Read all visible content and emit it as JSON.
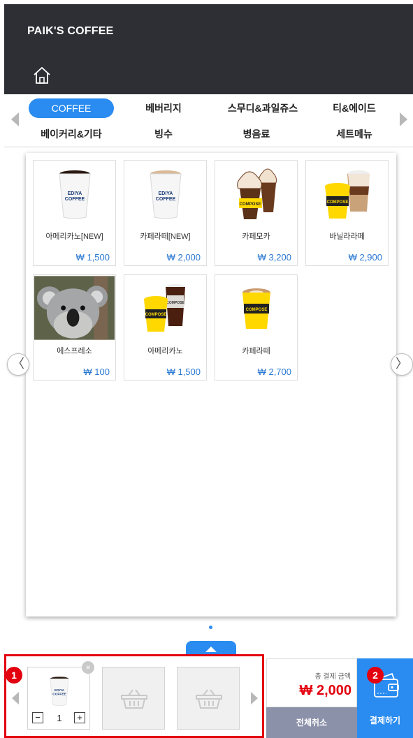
{
  "app": {
    "brand": "PAIK'S COFFEE"
  },
  "categories": [
    {
      "label": "COFFEE",
      "active": true
    },
    {
      "label": "베버리지",
      "active": false
    },
    {
      "label": "스무디&과일쥬스",
      "active": false
    },
    {
      "label": "티&에이드",
      "active": false
    },
    {
      "label": "베이커리&기타",
      "active": false
    },
    {
      "label": "빙수",
      "active": false
    },
    {
      "label": "병음료",
      "active": false
    },
    {
      "label": "세트메뉴",
      "active": false
    }
  ],
  "menu": [
    {
      "name": "아메리카노[NEW]",
      "price": "₩ 1,500",
      "cup_text": "EDIYA COFFEE",
      "image": "ediya-hot-cup"
    },
    {
      "name": "카페라떼[NEW]",
      "price": "₩ 2,000",
      "cup_text": "EDIYA COFFEE",
      "image": "ediya-latte-cup"
    },
    {
      "name": "카페모카",
      "price": "₩ 3,200",
      "cup_text": "COMPOSE",
      "image": "mocha-cup"
    },
    {
      "name": "바닐라라떼",
      "price": "₩ 2,900",
      "cup_text": "COMPOSE",
      "image": "vanilla-latte-cups"
    },
    {
      "name": "에스프레소",
      "price": "₩ 100",
      "image": "koala-photo"
    },
    {
      "name": "아메리카노",
      "price": "₩ 1,500",
      "cup_text": "COMPOSE",
      "image": "iced-americano-cups"
    },
    {
      "name": "카페라떼",
      "price": "₩ 2,700",
      "cup_text": "COMPOSE",
      "image": "cafe-latte-cup"
    }
  ],
  "cart": {
    "items": [
      {
        "image": "ediya-hot-cup",
        "quantity": "1",
        "remove": "×",
        "minus": "−",
        "plus": "+"
      }
    ],
    "empty_slots": 2
  },
  "checkout": {
    "total_label": "총 결제 금액",
    "total_amount": "₩ 2,000",
    "cancel_all": "전체취소",
    "pay": "결제하기"
  },
  "annotations": {
    "cart_badge": "1",
    "pay_badge": "2"
  },
  "colors": {
    "accent": "#2a8cf0",
    "header_bg": "#2d2f34",
    "price": "#2a79d3",
    "highlight": "#e3000f",
    "cancel_bg": "#8b91a9"
  },
  "nav": {
    "prev_glyph": "〈",
    "next_glyph": "〉"
  }
}
